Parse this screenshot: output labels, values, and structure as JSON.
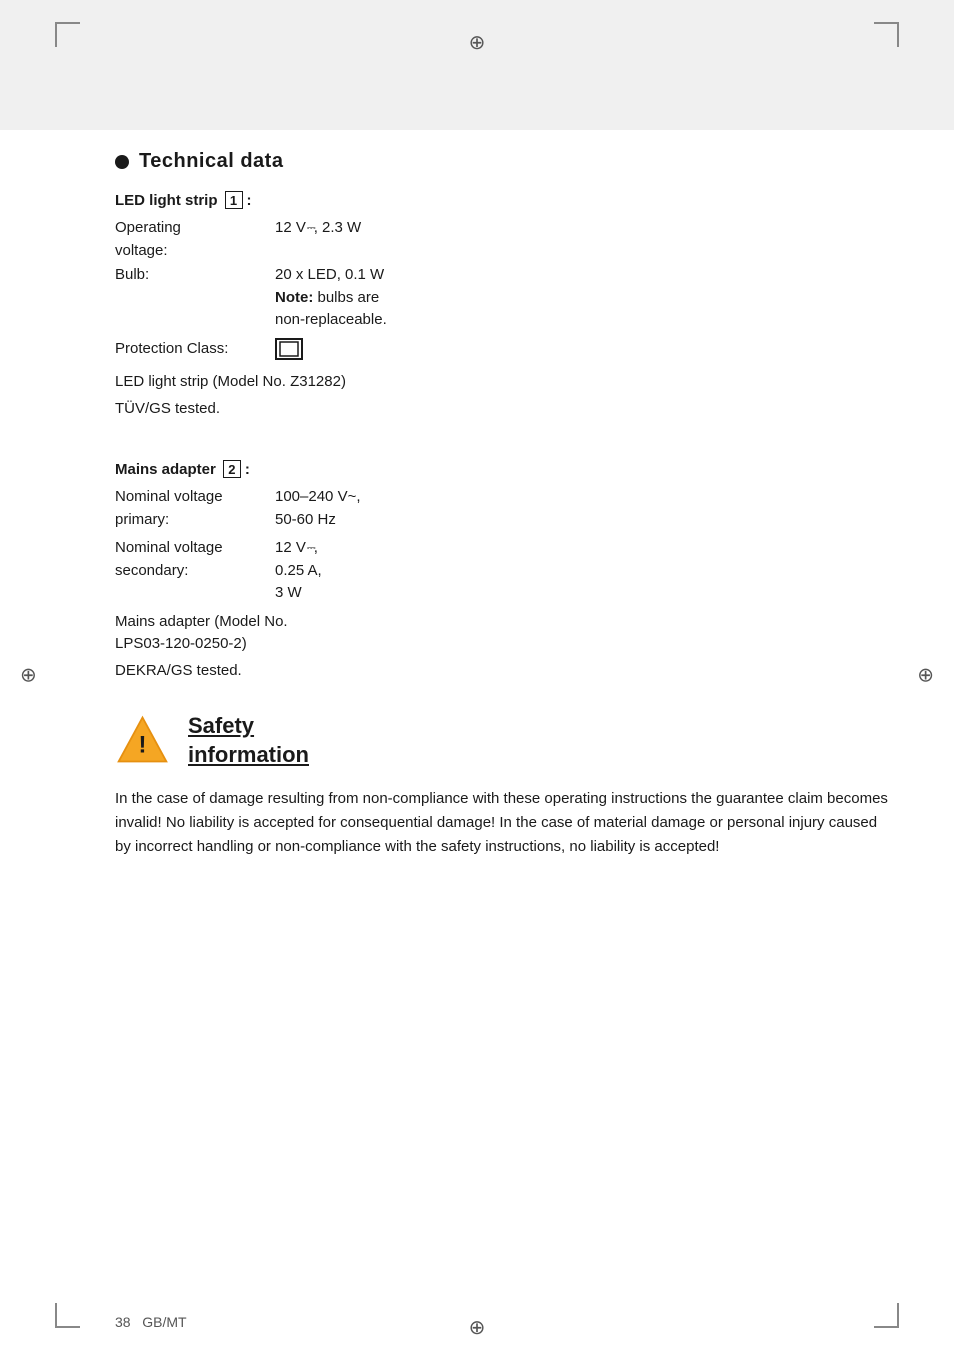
{
  "colors": {
    "bar": [
      {
        "color": "#4a4a4a",
        "flex": 2
      },
      {
        "color": "#888888",
        "flex": 1
      },
      {
        "color": "#b0b0b0",
        "flex": 1
      },
      {
        "color": "#d0d0d0",
        "flex": 1
      },
      {
        "color": "#e8e8e8",
        "flex": 1
      },
      {
        "color": "#f5f5f5",
        "flex": 1
      },
      {
        "color": "#ffffff",
        "flex": 1
      },
      {
        "color": "#f5f5f5",
        "flex": 1
      },
      {
        "color": "#eeeeee",
        "flex": 1
      },
      {
        "color": "#f5f000",
        "flex": 1
      },
      {
        "color": "#e600c8",
        "flex": 1
      },
      {
        "color": "#00b4e6",
        "flex": 1
      },
      {
        "color": "#0000cc",
        "flex": 1
      },
      {
        "color": "#cc0000",
        "flex": 1
      },
      {
        "color": "#00aa00",
        "flex": 1
      },
      {
        "color": "#1a1a1a",
        "flex": 1
      },
      {
        "color": "#e8e8e8",
        "flex": 1
      }
    ]
  },
  "section_title": "Technical data",
  "led_strip": {
    "heading": "LED light strip",
    "number": "1",
    "specs": [
      {
        "label": "Operating\nvoltage:",
        "value": "12 V ⎓, 2.3 W"
      },
      {
        "label": "Bulb:",
        "value": "20 x LED, 0.1 W"
      }
    ],
    "note_bold": "Note:",
    "note_text": " bulbs are non-replaceable.",
    "protection_label": "Protection Class:",
    "protection_symbol": "II",
    "model_text": "LED light strip (Model No. Z31282)",
    "test_text": "TÜV/GS tested."
  },
  "mains_adapter": {
    "heading": "Mains adapter",
    "number": "2",
    "specs": [
      {
        "label": "Nominal voltage\nprimary:",
        "value": "100–240 V~,\n50-60 Hz"
      },
      {
        "label": "Nominal voltage\nsecondary:",
        "value": "12 V ⎓,\n0.25 A,\n3 W"
      }
    ],
    "model_text": "Mains adapter (Model No. LPS03-120-0250-2)",
    "test_text": "DEKRA/GS tested."
  },
  "safety": {
    "heading_line1": "Safety",
    "heading_line2": "information",
    "body": "In the case of damage resulting from non-compliance with these operating instructions the guarantee claim becomes invalid! No liability is accepted for consequential damage! In the case of material damage or personal injury caused by incorrect handling or non-compliance with the safety instructions, no liability is accepted!"
  },
  "footer": {
    "page_number": "38",
    "locale": "GB/MT"
  }
}
